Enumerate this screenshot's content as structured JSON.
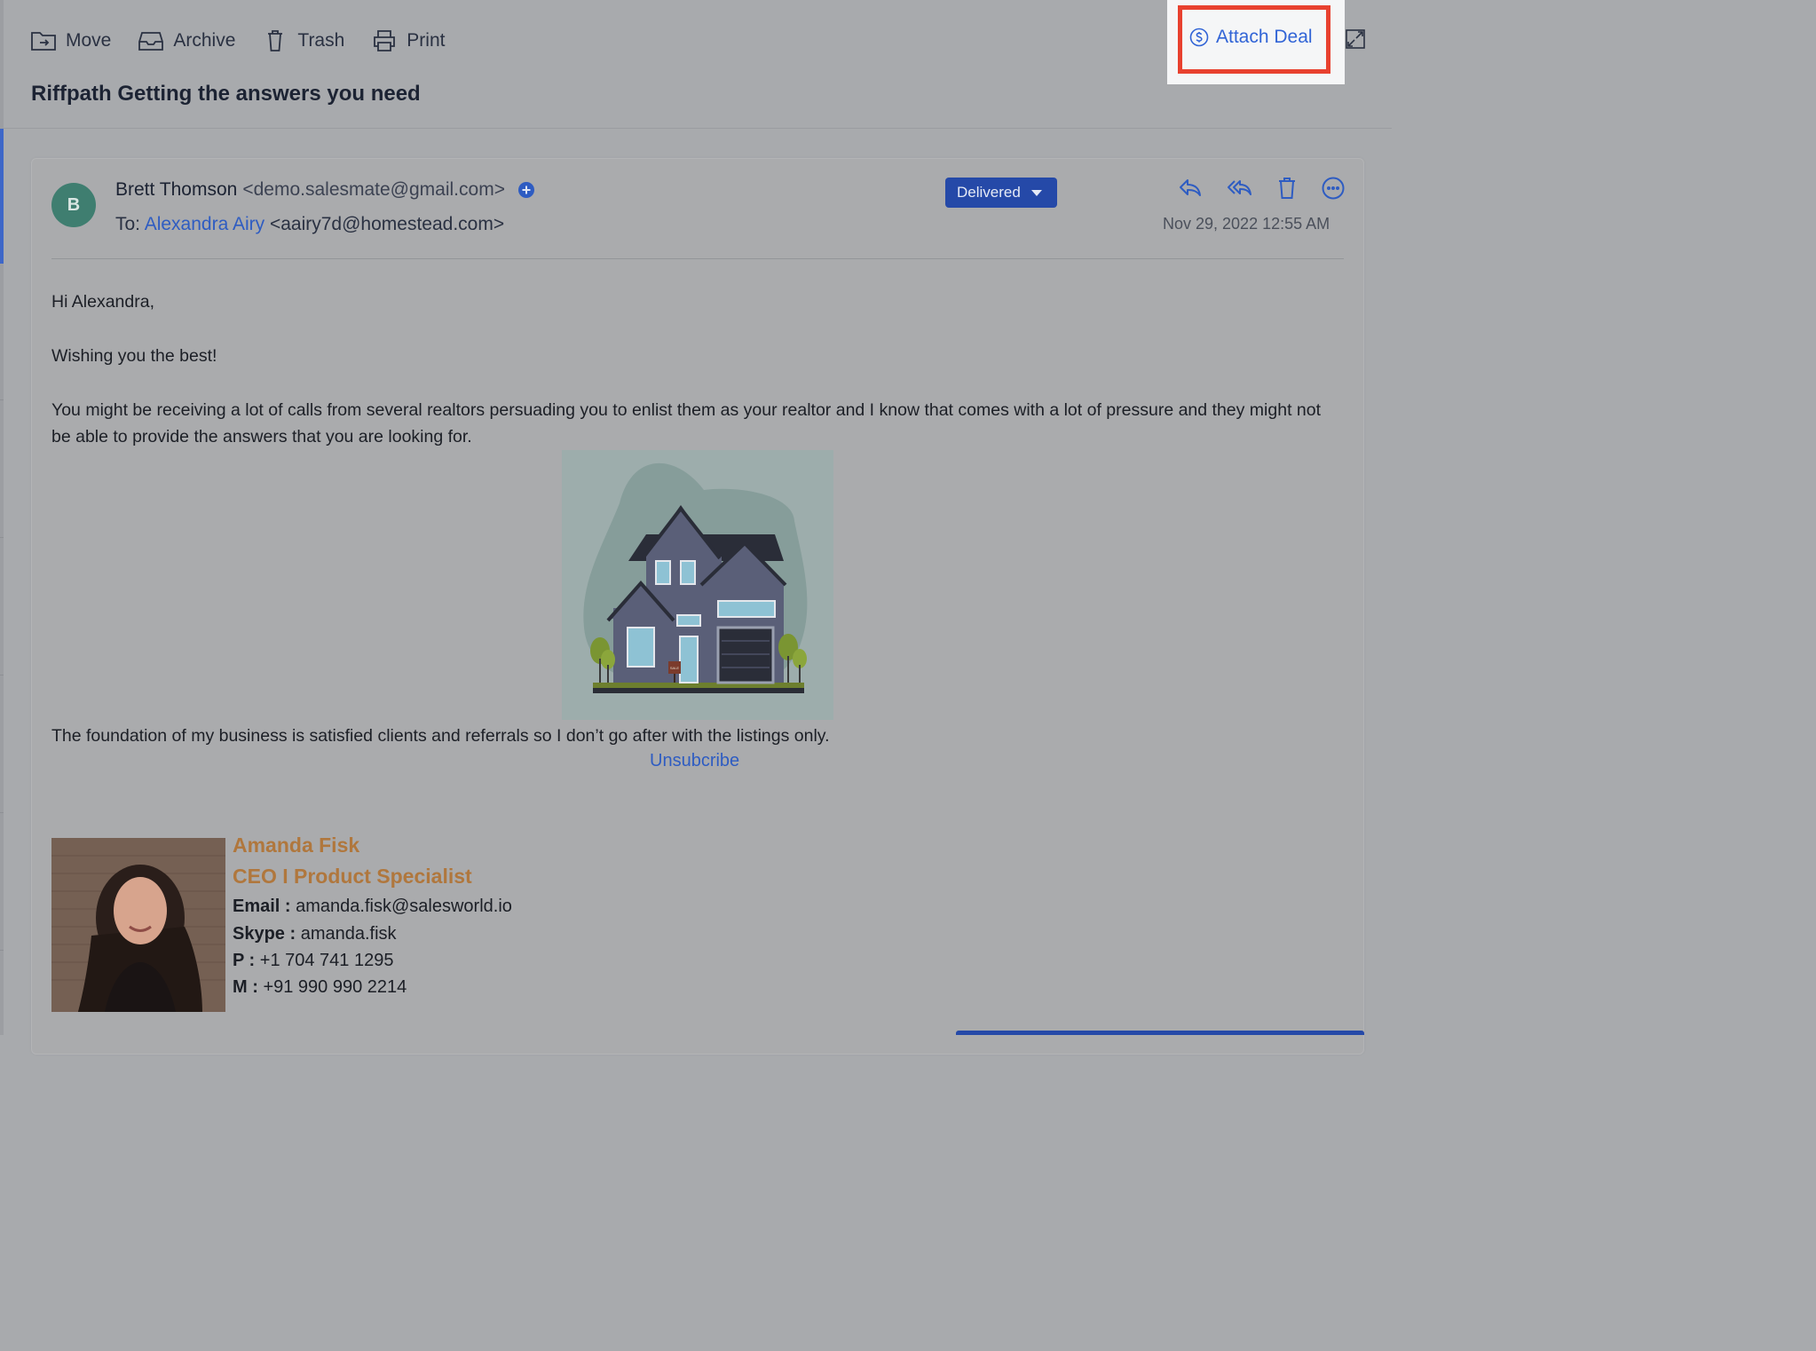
{
  "toolbar": {
    "move_label": "Move",
    "archive_label": "Archive",
    "trash_label": "Trash",
    "print_label": "Print",
    "attach_deal_label": "Attach Deal"
  },
  "email": {
    "subject": "Riffpath Getting the answers you need",
    "avatar_initial": "B",
    "from_name": "Brett Thomson",
    "from_email": "<demo.salesmate@gmail.com>",
    "to_prefix": "To:",
    "to_name": "Alexandra Airy",
    "to_email": "<aairy7d@homestead.com>",
    "status": "Delivered",
    "timestamp": "Nov 29, 2022 12:55 AM"
  },
  "body": {
    "greeting": "Hi Alexandra,",
    "wish": "Wishing you the best!",
    "para1": "You might be receiving a lot of calls from several realtors persuading you to enlist them as your realtor and I know that comes with a lot of pressure and they might not be able to provide the answers that you are looking for.",
    "house_sign": "SALE",
    "para2": "The foundation of my business is satisfied clients and referrals so I don’t go after with the listings only.",
    "unsubscribe": "Unsubcribe"
  },
  "signature": {
    "name": "Amanda Fisk",
    "title": "CEO I Product Specialist",
    "email_label": "Email :",
    "email_value": "amanda.fisk@salesworld.io",
    "skype_label": "Skype :",
    "skype_value": "amanda.fisk",
    "phone_label": "P :",
    "phone_value": "+1 704 741 1295",
    "mobile_label": "M :",
    "mobile_value": "+91 990 990 2214"
  },
  "colors": {
    "accent": "#3164d6",
    "status_badge": "#2549a8",
    "highlight_box": "#e8412f",
    "signature_orange": "#b0773d",
    "avatar": "#3f7e70"
  },
  "icons": [
    "folder-move-icon",
    "archive-icon",
    "trash-icon",
    "print-icon",
    "dollar-circle-icon",
    "expand-icon",
    "add-contact-icon",
    "reply-icon",
    "reply-all-icon",
    "delete-icon",
    "more-options-icon"
  ]
}
